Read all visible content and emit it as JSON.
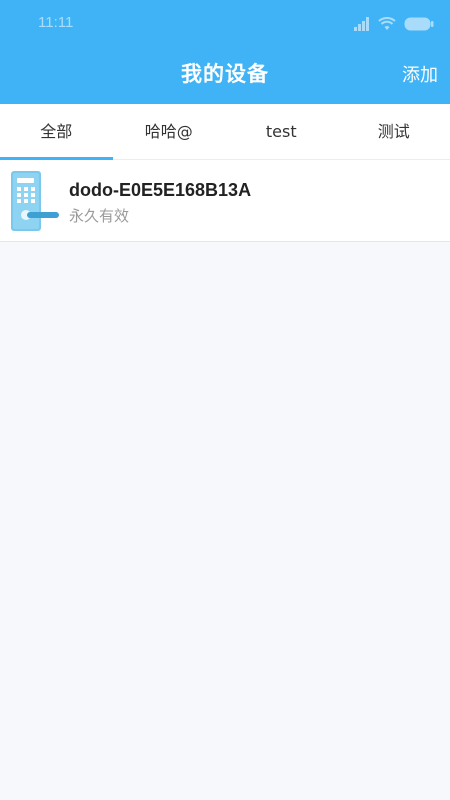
{
  "status_bar": {
    "time": "11:11"
  },
  "header": {
    "title": "我的设备",
    "add_label": "添加"
  },
  "tabs": [
    {
      "label": "全部",
      "active": true
    },
    {
      "label": "哈哈@",
      "active": false
    },
    {
      "label": "test",
      "active": false
    },
    {
      "label": "测试",
      "active": false
    }
  ],
  "devices": [
    {
      "name": "dodo-E0E5E168B13A",
      "status": "永久有效",
      "icon": "smart-lock-icon"
    }
  ],
  "colors": {
    "accent": "#3fb3f5",
    "background": "#f7f8fc",
    "muted_text": "#9a9a9a"
  }
}
